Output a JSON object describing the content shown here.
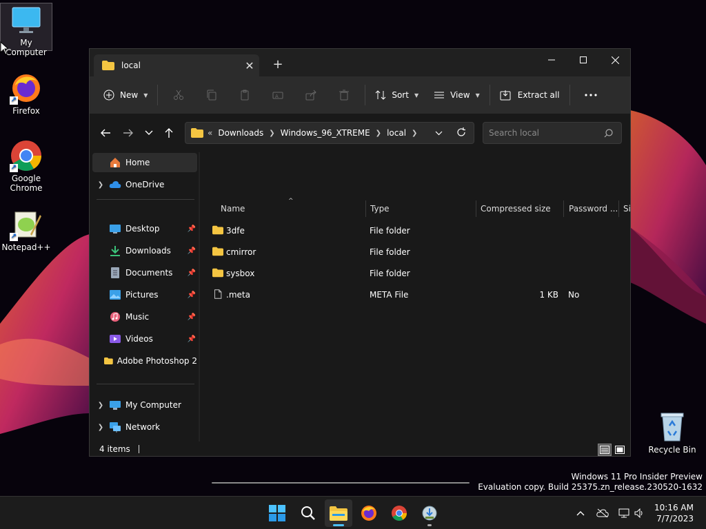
{
  "desktop": {
    "icons": [
      {
        "label": "My Computer",
        "icon": "monitor-icon"
      },
      {
        "label": "Firefox",
        "icon": "firefox-icon"
      },
      {
        "label": "Google Chrome",
        "icon": "chrome-icon"
      },
      {
        "label": "Notepad++",
        "icon": "notepadpp-icon"
      }
    ],
    "recycle_bin": "Recycle Bin"
  },
  "window": {
    "tab_title": "local",
    "controls": {
      "minimize": "minimize",
      "maximize": "maximize",
      "close": "close"
    },
    "toolbar": {
      "new_label": "New",
      "sort_label": "Sort",
      "view_label": "View",
      "extract_label": "Extract all",
      "more": "more-options"
    },
    "address": {
      "overflow": "«",
      "crumbs": [
        "Downloads",
        "Windows_96_XTREME",
        "local"
      ]
    },
    "search": {
      "placeholder": "Search local"
    },
    "nav": {
      "home": "Home",
      "onedrive": "OneDrive",
      "quick": [
        {
          "label": "Desktop",
          "icon": "desktop-icon"
        },
        {
          "label": "Downloads",
          "icon": "download-icon"
        },
        {
          "label": "Documents",
          "icon": "document-icon"
        },
        {
          "label": "Pictures",
          "icon": "picture-icon"
        },
        {
          "label": "Music",
          "icon": "music-icon"
        },
        {
          "label": "Videos",
          "icon": "video-icon"
        }
      ],
      "adobe": "Adobe Photoshop 2",
      "mycomputer": "My Computer",
      "network": "Network"
    },
    "columns": {
      "name": "Name",
      "type": "Type",
      "compressed": "Compressed size",
      "password": "Password ...",
      "size": "Si"
    },
    "files": [
      {
        "name": "3dfe",
        "type": "File folder",
        "compressed": "",
        "password": "",
        "kind": "folder"
      },
      {
        "name": "cmirror",
        "type": "File folder",
        "compressed": "",
        "password": "",
        "kind": "folder"
      },
      {
        "name": "sysbox",
        "type": "File folder",
        "compressed": "",
        "password": "",
        "kind": "folder"
      },
      {
        "name": ".meta",
        "type": "META File",
        "compressed": "1 KB",
        "password": "No",
        "kind": "file"
      }
    ],
    "status": "4 items"
  },
  "watermark": {
    "line1": "Windows 11 Pro Insider Preview",
    "line2": "Evaluation copy. Build 25375.zn_release.230520-1632"
  },
  "taskbar": {
    "clock_time": "10:16 AM",
    "clock_date": "7/7/2023"
  },
  "colors": {
    "folder": "#f4c542",
    "accent": "#4cc2ff",
    "onedrive": "#2f8fe8"
  }
}
